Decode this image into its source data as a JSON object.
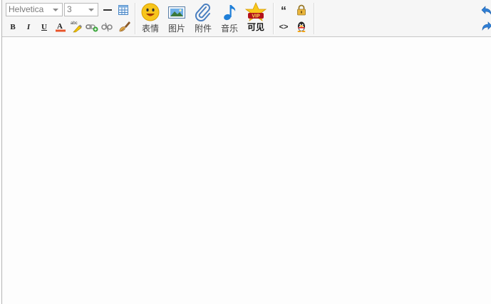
{
  "toolbar": {
    "font_family": "Helvetica",
    "font_size": "3",
    "format_buttons": {
      "bold": "B",
      "italic": "I",
      "underline": "U"
    },
    "big_buttons": {
      "emoticon": "表情",
      "image": "图片",
      "attachment": "附件",
      "music": "音乐",
      "vip_visible": "可见"
    },
    "vip_badge": "VIP",
    "quote_glyph": "“",
    "code_glyph": "<>"
  },
  "colors": {
    "toolbar_bg": "#f6f6f6",
    "content_bg": "#fdfdfd",
    "font_color_bar": "#e8542a",
    "undo_redo_blue": "#2f7fd6"
  }
}
